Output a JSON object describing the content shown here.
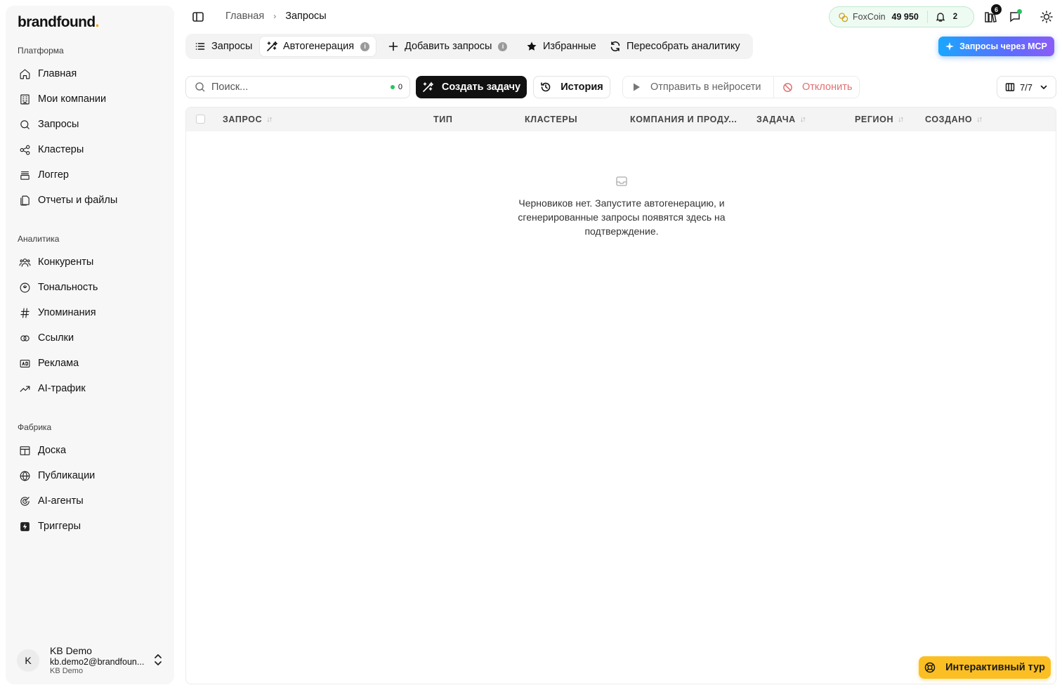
{
  "brand": {
    "name": "brandfound",
    "dot": "."
  },
  "sidebar": {
    "sections": [
      {
        "label": "Платформа",
        "items": [
          {
            "label": "Главная",
            "icon": "home-icon"
          },
          {
            "label": "Мои компании",
            "icon": "building-icon"
          },
          {
            "label": "Запросы",
            "icon": "search-icon"
          },
          {
            "label": "Кластеры",
            "icon": "share-icon"
          },
          {
            "label": "Логгер",
            "icon": "logger-icon"
          },
          {
            "label": "Отчеты и файлы",
            "icon": "files-icon"
          }
        ]
      },
      {
        "label": "Аналитика",
        "items": [
          {
            "label": "Конкуренты",
            "icon": "users-icon"
          },
          {
            "label": "Тональность",
            "icon": "gauge-icon"
          },
          {
            "label": "Упоминания",
            "icon": "hash-icon"
          },
          {
            "label": "Ссылки",
            "icon": "link-icon"
          },
          {
            "label": "Реклама",
            "icon": "ad-icon"
          },
          {
            "label": "AI-трафик",
            "icon": "trend-icon"
          }
        ]
      },
      {
        "label": "Фабрика",
        "items": [
          {
            "label": "Доска",
            "icon": "board-icon"
          },
          {
            "label": "Публикации",
            "icon": "globe-icon"
          },
          {
            "label": "AI-агенты",
            "icon": "agent-icon"
          },
          {
            "label": "Триггеры",
            "icon": "bolt-icon"
          }
        ]
      }
    ],
    "user": {
      "initial": "K",
      "name": "KB Demo",
      "email": "kb.demo2@brandfoun...",
      "org": "KB Demo"
    }
  },
  "breadcrumb": {
    "home": "Главная",
    "separator": "›",
    "current": "Запросы"
  },
  "coins": {
    "label": "FoxCoin",
    "value": "49 950",
    "notifications": "2"
  },
  "top_badge": "6",
  "tabs": [
    {
      "label": "Запросы",
      "icon": "list-icon"
    },
    {
      "label": "Автогенерация",
      "icon": "magic-wand-icon",
      "active": true,
      "info": "i"
    },
    {
      "label": "Добавить запросы",
      "icon": "plus-icon",
      "info": "i"
    },
    {
      "label": "Избранные",
      "icon": "star-icon"
    },
    {
      "label": "Пересобрать аналитику",
      "icon": "refresh-icon"
    }
  ],
  "mcp_button": "Запросы через MCP",
  "toolbar": {
    "search_placeholder": "Поиск...",
    "search_count": "0",
    "create_task": "Создать задачу",
    "history": "История",
    "send_to_ai": "Отправить в нейросети",
    "reject": "Отклонить",
    "columns_count": "7/7"
  },
  "table": {
    "columns": [
      {
        "label": "ЗАПРОС",
        "sortable": true
      },
      {
        "label": "ТИП",
        "sortable": false
      },
      {
        "label": "КЛАСТЕРЫ",
        "sortable": false
      },
      {
        "label": "КОМПАНИЯ И ПРОДУ...",
        "sortable": false
      },
      {
        "label": "ЗАДАЧА",
        "sortable": true
      },
      {
        "label": "РЕГИОН",
        "sortable": true
      },
      {
        "label": "СОЗДАНО",
        "sortable": true
      }
    ],
    "empty_message": "Черновиков нет. Запустите автогенерацию, и сгенерированные запросы появятся здесь на подтверждение."
  },
  "tour_button": "Интерактивный тур",
  "colors": {
    "accent_green": "#22c55e",
    "tour_yellow": "#fbbf24",
    "reject_red": "#e07070"
  }
}
